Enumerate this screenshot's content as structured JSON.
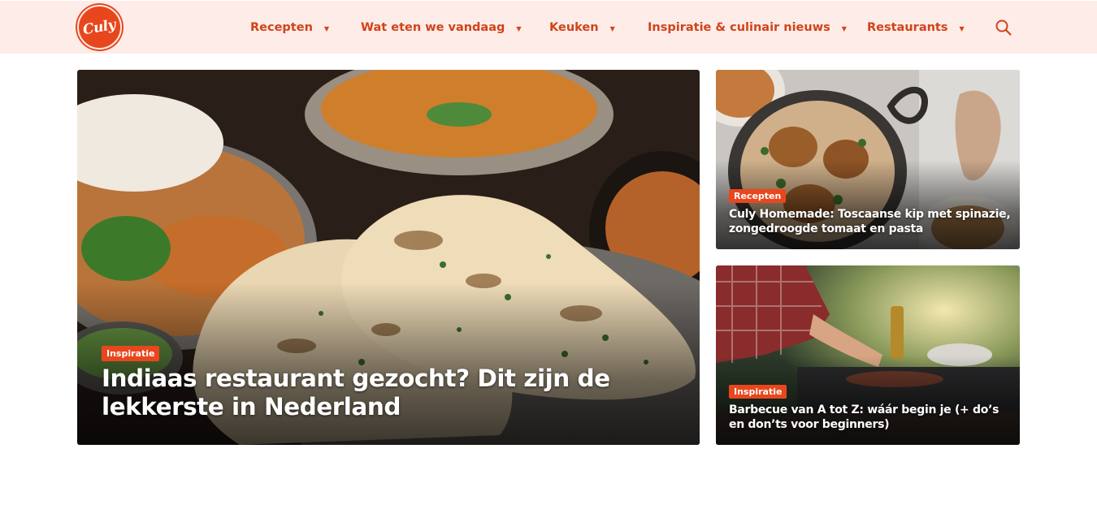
{
  "header": {
    "logo_text": "Culy",
    "nav": [
      {
        "label": "Recepten"
      },
      {
        "label": "Wat eten we vandaag"
      },
      {
        "label": "Keuken"
      },
      {
        "label": "Inspiratie & culinair nieuws"
      },
      {
        "label": "Restaurants"
      }
    ],
    "search_icon": "search-icon",
    "caret_icon": "caret-down-icon"
  },
  "colors": {
    "brand": "#e8471d",
    "header_bg": "#fdece8",
    "nav_text": "#d14318"
  },
  "articles": [
    {
      "category": "Inspiratie",
      "title": "Indiaas restaurant gezocht? Dit zijn de lekkerste in Nederland"
    },
    {
      "category": "Recepten",
      "title": "Culy Homemade: Toscaanse kip met spinazie, zongedroogde tomaat en pasta"
    },
    {
      "category": "Inspiratie",
      "title": "Barbecue van A tot Z: wáár begin je (+ do’s en don’ts voor beginners)"
    }
  ]
}
